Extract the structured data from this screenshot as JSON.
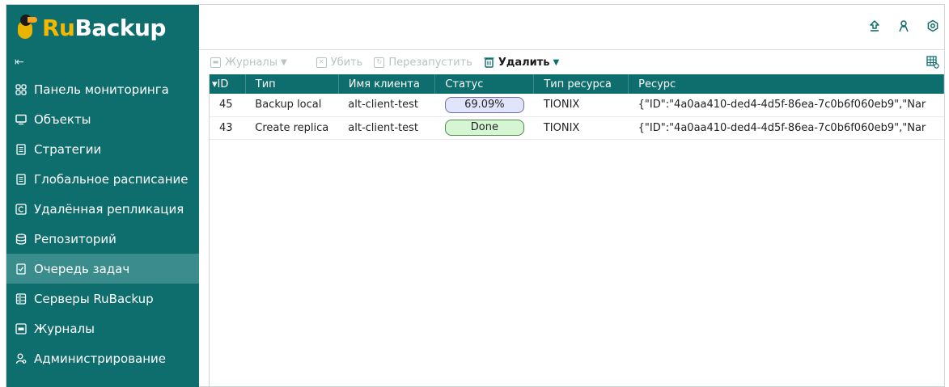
{
  "app": {
    "logo_ru": "Ru",
    "logo_backup": "Backup"
  },
  "sidebar": {
    "collapse_icon": "collapse-menu-icon",
    "items": [
      {
        "label": "Панель мониторинга",
        "icon": "dashboard-icon"
      },
      {
        "label": "Объекты",
        "icon": "monitor-icon"
      },
      {
        "label": "Стратегии",
        "icon": "document-icon"
      },
      {
        "label": "Глобальное расписание",
        "icon": "document-icon"
      },
      {
        "label": "Удалённая репликация",
        "icon": "replication-icon"
      },
      {
        "label": "Репозиторий",
        "icon": "database-icon"
      },
      {
        "label": "Очередь задач",
        "icon": "task-queue-icon",
        "active": true
      },
      {
        "label": "Серверы RuBackup",
        "icon": "server-icon"
      },
      {
        "label": "Журналы",
        "icon": "log-icon"
      },
      {
        "label": "Администрирование",
        "icon": "users-icon"
      }
    ]
  },
  "topbar": {
    "icons": [
      "upload-icon",
      "user-icon",
      "settings-icon"
    ]
  },
  "toolbar": {
    "logs_label": "Журналы",
    "kill_label": "Убить",
    "restart_label": "Перезапустить",
    "delete_label": "Удалить",
    "columns_icon": "table-columns-icon"
  },
  "table": {
    "columns": [
      "ID",
      "Тип",
      "Имя клиента",
      "Статус",
      "Тип ресурса",
      "Ресурс"
    ],
    "sort_indicator": "▾",
    "rows": [
      {
        "id": "45",
        "type": "Backup local",
        "client": "alt-client-test",
        "status": "69.09%",
        "status_kind": "running",
        "resource_type": "TIONIX",
        "resource": "{\"ID\":\"4a0aa410-ded4-4d5f-86ea-7c0b6f060eb9\",\"Nar"
      },
      {
        "id": "43",
        "type": "Create replica",
        "client": "alt-client-test",
        "status": "Done",
        "status_kind": "done",
        "resource_type": "TIONIX",
        "resource": "{\"ID\":\"4a0aa410-ded4-4d5f-86ea-7c0b6f060eb9\",\"Nar"
      }
    ]
  },
  "colors": {
    "sidebar_bg": "#0e6e6e",
    "active_item_bg": "#3b8c8c",
    "logo_ru": "#f5b800",
    "running_status_bg": "#e2e4fb",
    "done_status_bg": "#d6f5d3"
  }
}
